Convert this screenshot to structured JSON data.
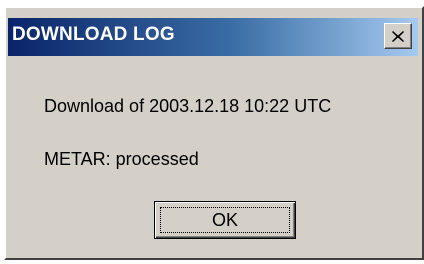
{
  "window": {
    "title": "DOWNLOAD LOG",
    "close_icon": "close-icon"
  },
  "messages": {
    "download": "Download of 2003.12.18 10:22 UTC",
    "metar": "METAR: processed"
  },
  "buttons": {
    "ok_label": "OK"
  },
  "colors": {
    "titlebar_start": "#0a246a",
    "titlebar_end": "#a6caf0",
    "dialog_face": "#d4d0c8"
  }
}
